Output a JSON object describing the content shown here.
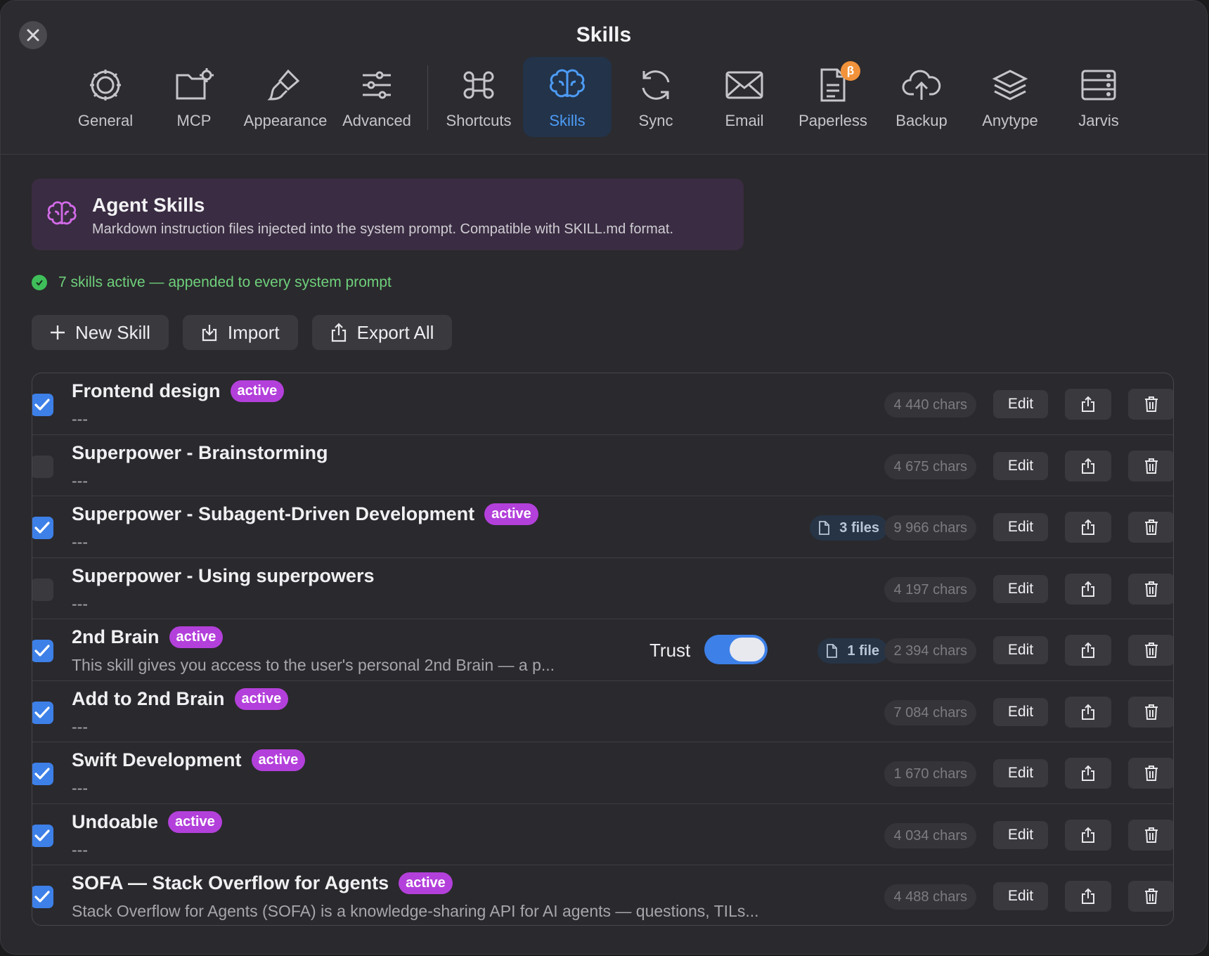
{
  "window": {
    "title": "Skills"
  },
  "tabs": [
    {
      "label": "General",
      "icon": "gear-icon"
    },
    {
      "label": "MCP",
      "icon": "folder-gear-icon"
    },
    {
      "label": "Appearance",
      "icon": "paintbrush-icon"
    },
    {
      "label": "Advanced",
      "icon": "sliders-icon"
    },
    {
      "label": "Shortcuts",
      "icon": "command-icon"
    },
    {
      "label": "Skills",
      "icon": "brain-icon",
      "selected": true
    },
    {
      "label": "Sync",
      "icon": "sync-icon"
    },
    {
      "label": "Email",
      "icon": "envelope-icon"
    },
    {
      "label": "Paperless",
      "icon": "document-icon",
      "badge": "β"
    },
    {
      "label": "Backup",
      "icon": "cloud-upload-icon"
    },
    {
      "label": "Anytype",
      "icon": "layers-icon"
    },
    {
      "label": "Jarvis",
      "icon": "server-icon"
    }
  ],
  "banner": {
    "title": "Agent Skills",
    "subtitle": "Markdown instruction files injected into the system prompt. Compatible with SKILL.md format."
  },
  "status": {
    "text": "7 skills active — appended to every system prompt"
  },
  "actions": {
    "new_skill": "New Skill",
    "import": "Import",
    "export_all": "Export All"
  },
  "labels": {
    "edit": "Edit",
    "active": "active",
    "trust": "Trust"
  },
  "skills": [
    {
      "name": "Frontend design",
      "active": true,
      "desc": "---",
      "chars": "4 440 chars"
    },
    {
      "name": "Superpower - Brainstorming",
      "active": false,
      "desc": "---",
      "chars": "4 675 chars"
    },
    {
      "name": "Superpower - Subagent-Driven Development",
      "active": true,
      "desc": "---",
      "chars": "9 966 chars",
      "files": "3 files"
    },
    {
      "name": "Superpower - Using superpowers",
      "active": false,
      "desc": "---",
      "chars": "4 197 chars"
    },
    {
      "name": "2nd Brain",
      "active": true,
      "desc": "This skill gives you access to the user's personal 2nd Brain — a p...",
      "chars": "2 394 chars",
      "files": "1 file",
      "trust": true
    },
    {
      "name": "Add to 2nd Brain",
      "active": true,
      "desc": "---",
      "chars": "7 084 chars"
    },
    {
      "name": "Swift Development",
      "active": true,
      "desc": "---",
      "chars": "1 670 chars"
    },
    {
      "name": "Undoable",
      "active": true,
      "desc": "---",
      "chars": "4 034 chars"
    },
    {
      "name": "SOFA — Stack Overflow for Agents",
      "active": true,
      "desc": "Stack Overflow for Agents (SOFA) is a knowledge-sharing API for AI agents — questions, TILs...",
      "chars": "4 488 chars"
    }
  ],
  "colors": {
    "accent": "#3d80e8",
    "active_badge": "#b340db",
    "status_green": "#3fbf5a",
    "beta_badge": "#f2923a"
  }
}
